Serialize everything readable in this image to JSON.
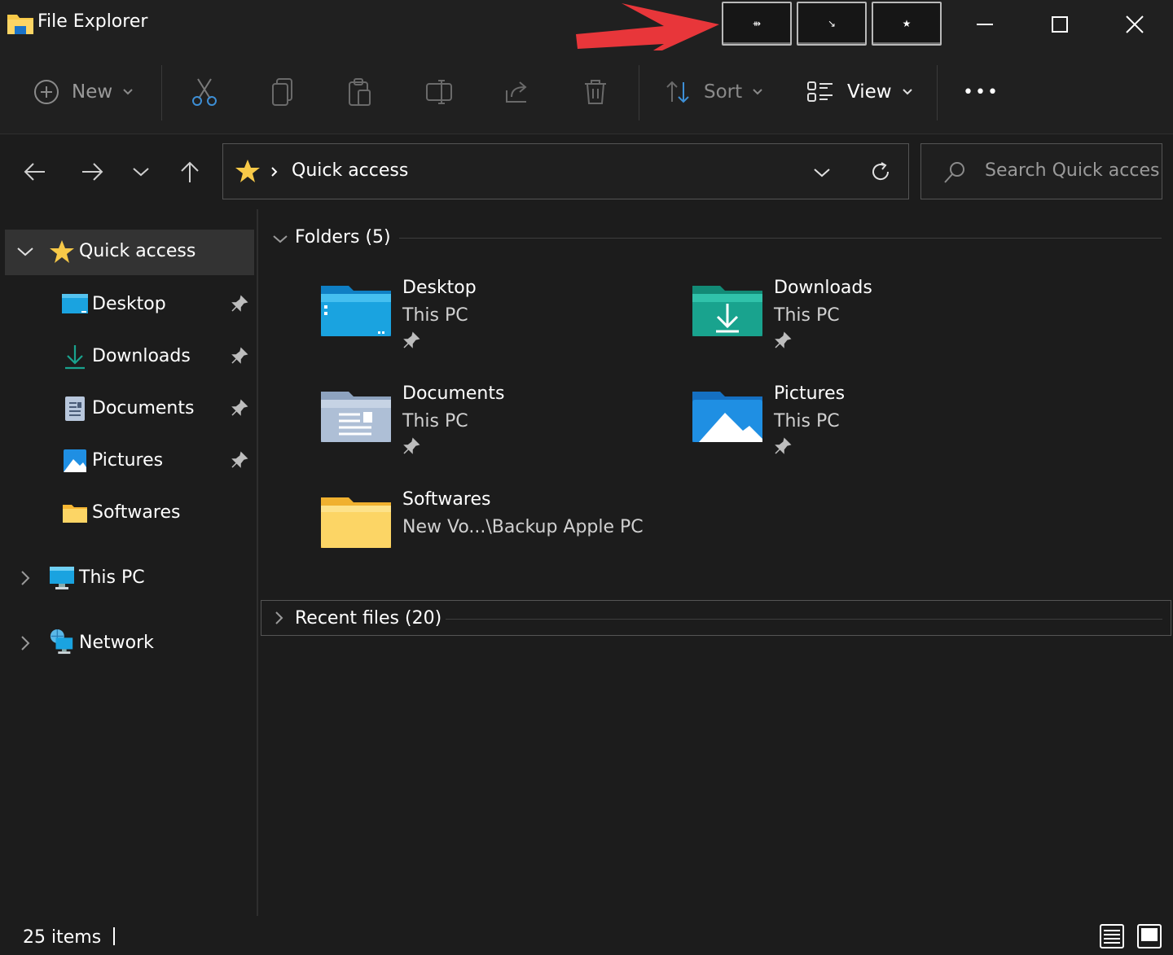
{
  "window": {
    "title": "File Explorer"
  },
  "title_buttons": {
    "custom": [
      {
        "name": "pin-button",
        "glyph": "⇻"
      },
      {
        "name": "minimize-to-tray-button",
        "glyph": "↘"
      },
      {
        "name": "favorite-button",
        "glyph": "★"
      }
    ]
  },
  "toolbar": {
    "new_label": "New",
    "sort_label": "Sort",
    "view_label": "View",
    "more_label": "•••"
  },
  "nav": {
    "breadcrumb_current": "Quick access"
  },
  "search": {
    "placeholder": "Search Quick access"
  },
  "sidebar": {
    "quick_access": "Quick access",
    "items": [
      {
        "label": "Desktop"
      },
      {
        "label": "Downloads"
      },
      {
        "label": "Documents"
      },
      {
        "label": "Pictures"
      },
      {
        "label": "Softwares"
      }
    ],
    "this_pc": "This PC",
    "network": "Network"
  },
  "main": {
    "folders_header": "Folders (5)",
    "folders": [
      {
        "name": "Desktop",
        "location": "This PC"
      },
      {
        "name": "Downloads",
        "location": "This PC"
      },
      {
        "name": "Documents",
        "location": "This PC"
      },
      {
        "name": "Pictures",
        "location": "This PC"
      },
      {
        "name": "Softwares",
        "location": "New Vo...\\Backup Apple PC"
      }
    ],
    "recent_header": "Recent files (20)"
  },
  "status": {
    "item_count": "25 items"
  },
  "colors": {
    "accent_arrow": "#e8363a",
    "folder_yellow": "#f7c948",
    "folder_blue": "#1aa3e0",
    "folder_teal": "#19a38e"
  }
}
